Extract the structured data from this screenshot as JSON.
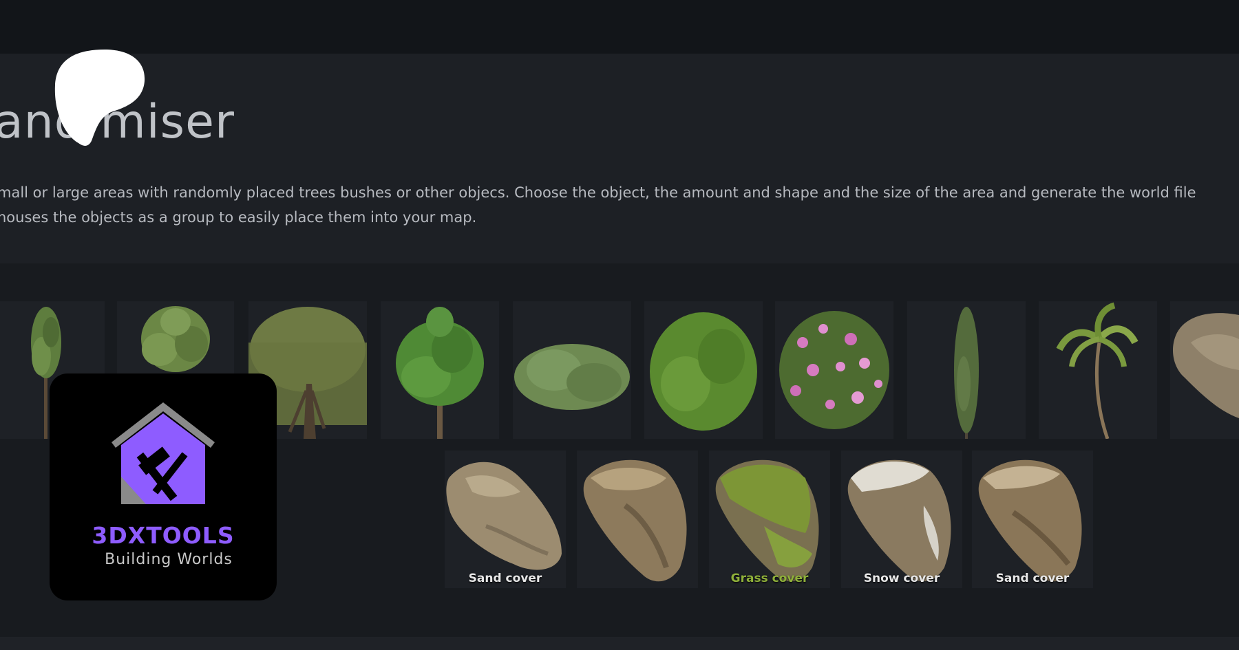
{
  "page": {
    "title": "and miser",
    "description_lines": [
      "mall or large areas with randomly placed trees bushes or other objecs. Choose the object, the amount and shape and the size of the area and generate the world file",
      "houses the objects as a group to easily place them into your map."
    ]
  },
  "gallery": {
    "rock_captions": [
      "Sand cover",
      "",
      "Grass cover",
      "Snow cover",
      "Sand cover"
    ]
  },
  "logo": {
    "brand": "3DXTOOLS",
    "tagline": "Building Worlds",
    "accent_color": "#8e5cff"
  },
  "colors": {
    "background": "#16191e",
    "hero": "#1d2025",
    "tile": "#1e2126"
  }
}
